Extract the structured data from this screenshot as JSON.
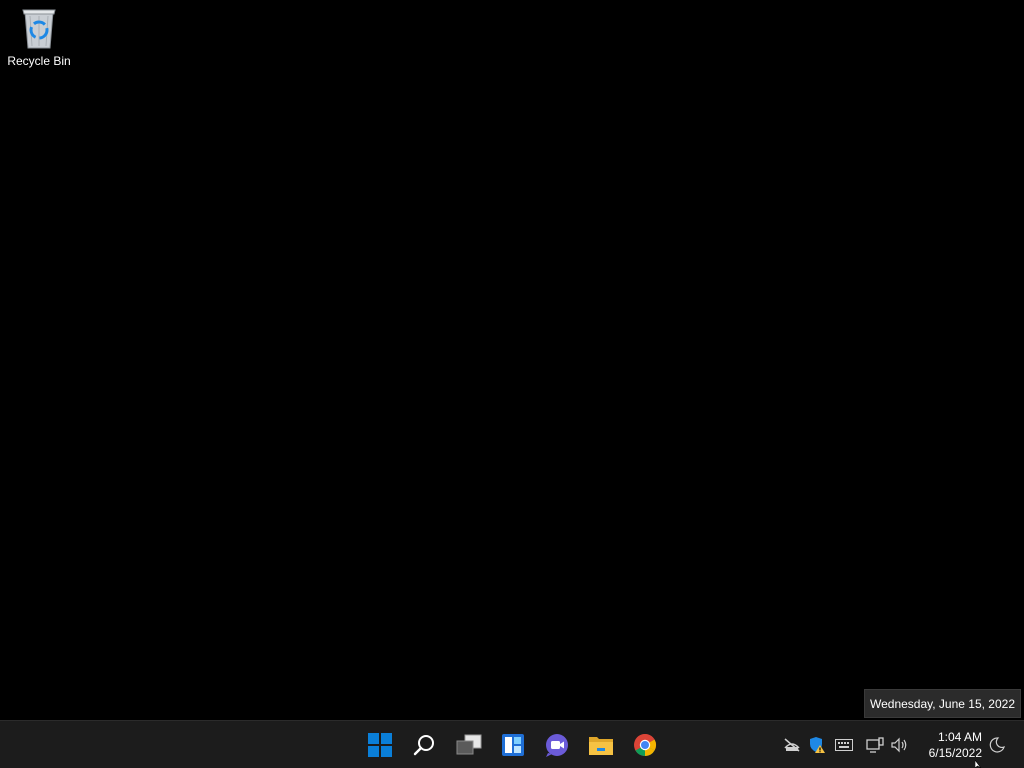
{
  "desktop": {
    "icons": [
      {
        "label": "Recycle Bin",
        "icon": "recycle-bin-icon"
      }
    ]
  },
  "taskbar": {
    "apps": [
      {
        "name": "Start",
        "icon": "windows-logo-icon"
      },
      {
        "name": "Search",
        "icon": "search-icon"
      },
      {
        "name": "Task View",
        "icon": "task-view-icon"
      },
      {
        "name": "Widgets",
        "icon": "widgets-icon"
      },
      {
        "name": "Chat",
        "icon": "teams-chat-icon"
      },
      {
        "name": "File Explorer",
        "icon": "folder-icon"
      },
      {
        "name": "Google Chrome",
        "icon": "chrome-icon"
      }
    ],
    "tray": {
      "icons": [
        "network-disconnected-icon",
        "windows-security-warning-icon",
        "keyboard-icon",
        "display-icon",
        "volume-icon"
      ],
      "time": "1:04 AM",
      "date": "6/15/2022",
      "focus_icon": "focus-assist-moon-icon"
    }
  },
  "tooltip": {
    "text": "Wednesday, June 15, 2022"
  },
  "colors": {
    "taskbar": "#1c1c1c",
    "accent_blue": "#0a7fd9",
    "folder_yellow": "#f6c243",
    "chat_purple": "#6b5bd8"
  }
}
